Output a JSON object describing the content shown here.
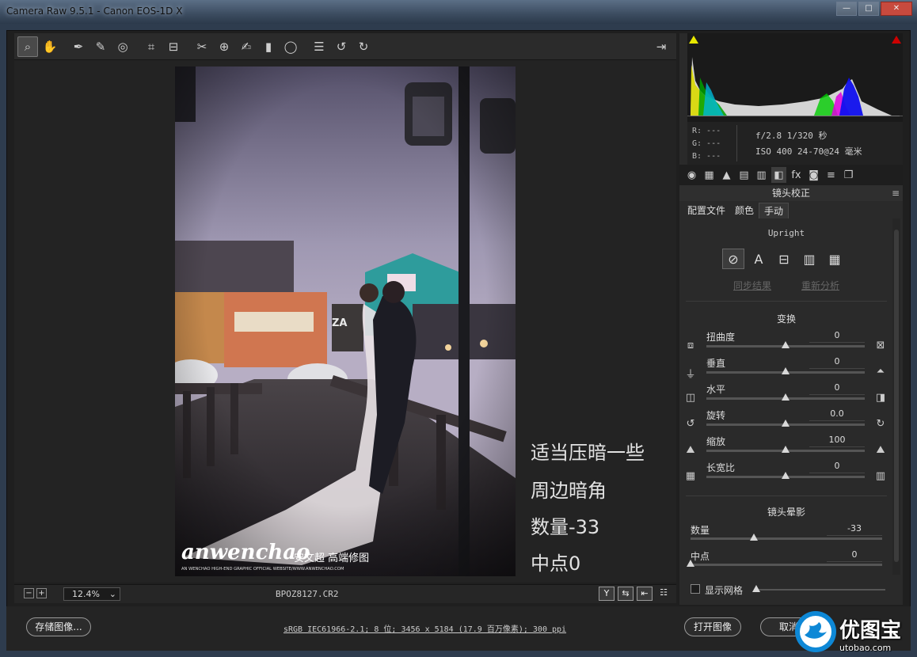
{
  "window": {
    "title": "Camera Raw 9.5.1 - Canon EOS-1D X",
    "controls": [
      "—",
      "□",
      "✕"
    ]
  },
  "toolbar": {
    "tools": [
      {
        "name": "zoom-tool",
        "icon": "magnifier-icon",
        "glyph": "⌕",
        "active": true
      },
      {
        "name": "hand-tool",
        "icon": "hand-icon",
        "glyph": "✋"
      },
      {
        "name": "white-balance-tool",
        "icon": "eyedropper-icon",
        "glyph": "✒"
      },
      {
        "name": "color-sampler-tool",
        "icon": "color-sampler-icon",
        "glyph": "✎"
      },
      {
        "name": "targeted-adjustment-tool",
        "icon": "target-adjust-icon",
        "glyph": "◎"
      },
      {
        "name": "crop-tool",
        "icon": "crop-icon",
        "glyph": "⌗"
      },
      {
        "name": "straighten-tool",
        "icon": "straighten-icon",
        "glyph": "⊟"
      },
      {
        "name": "spot-removal-tool",
        "icon": "spot-removal-icon",
        "glyph": "✂"
      },
      {
        "name": "red-eye-tool",
        "icon": "red-eye-icon",
        "glyph": "⊕"
      },
      {
        "name": "adjustment-brush-tool",
        "icon": "brush-icon",
        "glyph": "✍"
      },
      {
        "name": "graduated-filter-tool",
        "icon": "graduated-filter-icon",
        "glyph": "▮"
      },
      {
        "name": "radial-filter-tool",
        "icon": "radial-filter-icon",
        "glyph": "◯"
      },
      {
        "name": "preferences-tool",
        "icon": "list-icon",
        "glyph": "☰"
      },
      {
        "name": "rotate-ccw-tool",
        "icon": "rotate-left-icon",
        "glyph": "↺"
      },
      {
        "name": "rotate-cw-tool",
        "icon": "rotate-right-icon",
        "glyph": "↻"
      }
    ],
    "export_icon": "⇥"
  },
  "canvas": {
    "overlay_lines": [
      "适当压暗一些",
      "周边暗角",
      "数量-33",
      "中点0"
    ],
    "photo_watermark_main": "anwenchao",
    "photo_watermark_cn": "安文超 高端修图",
    "photo_watermark_sub": "AN WENCHAO HIGH-END GRAPHIC OFFICIAL WEBSITE/WWW.ANWENCHAO.COM",
    "photo_sign": "ZA"
  },
  "status": {
    "zoom_minus": "−",
    "zoom_plus": "+",
    "zoom": "12.4%",
    "filename": "BPOZ8127.CR2",
    "view_buttons": [
      "Y",
      "⇆",
      "⇤",
      "☷"
    ]
  },
  "histogram": {
    "colors": {
      "red_clip": "#cc0000",
      "shadow_clip": "#e8e800"
    }
  },
  "exif": {
    "r": "R:  ---",
    "g": "G:  ---",
    "b": "B:  ---",
    "line1": "f/2.8  1/320 秒",
    "line2": "ISO 400  24-70@24 毫米"
  },
  "panel": {
    "tabs": [
      "◉",
      "▦",
      "▲",
      "▤",
      "▥",
      "◧",
      "fx",
      "◙",
      "≡",
      "❐"
    ],
    "title": "镜头校正",
    "menu_icon": "≡",
    "subtabs": [
      "配置文件",
      "颜色",
      "手动"
    ],
    "upright": {
      "label": "Upright",
      "buttons": [
        "⊘",
        "A",
        "⊟",
        "▥",
        "▦"
      ],
      "sync_link": "同步结果",
      "reanalyze_link": "重新分析"
    },
    "transform": {
      "title": "变换",
      "sliders": [
        {
          "label": "扭曲度",
          "value": "0",
          "pos": 0.5,
          "icon_l": "⧈",
          "icon_r": "⊠"
        },
        {
          "label": "垂直",
          "value": "0",
          "pos": 0.5,
          "icon_l": "⏚",
          "icon_r": "⏶"
        },
        {
          "label": "水平",
          "value": "0",
          "pos": 0.5,
          "icon_l": "◫",
          "icon_r": "◨"
        },
        {
          "label": "旋转",
          "value": "0.0",
          "pos": 0.5,
          "icon_l": "↺",
          "icon_r": "↻"
        },
        {
          "label": "缩放",
          "value": "100",
          "pos": 0.5,
          "icon_l": "⛰",
          "icon_r": "⛰"
        },
        {
          "label": "长宽比",
          "value": "0",
          "pos": 0.5,
          "icon_l": "▦",
          "icon_r": "▥"
        }
      ]
    },
    "vignette": {
      "title": "镜头晕影",
      "sliders": [
        {
          "label": "数量",
          "value": "-33",
          "pos": 0.33
        },
        {
          "label": "中点",
          "value": "0",
          "pos": 0.0
        }
      ]
    },
    "grid": {
      "label": "显示网格",
      "checked": false
    }
  },
  "footer": {
    "save_label": "存储图像...",
    "workflow": "sRGB IEC61966-2.1; 8 位; 3456 x 5184 (17.9 百万像素); 300 ppi",
    "open_label": "打开图像",
    "cancel_label": "取消"
  },
  "watermark": {
    "text": "优图宝",
    "domain": "utobao.com"
  }
}
